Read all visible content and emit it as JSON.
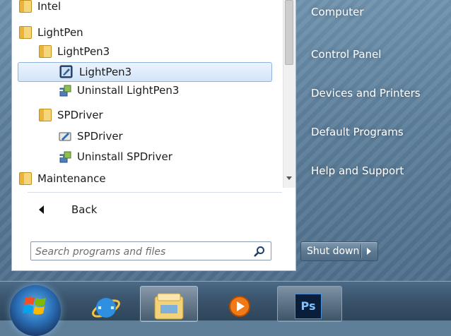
{
  "programs": {
    "items": [
      {
        "label": "Intel",
        "kind": "folder",
        "icon": "folder-icon",
        "indent": 0
      },
      {
        "label": "LightPen",
        "kind": "folder",
        "icon": "folder-icon",
        "indent": 0
      },
      {
        "label": "LightPen3",
        "kind": "folder",
        "icon": "folder-icon",
        "indent": 1
      },
      {
        "label": "LightPen3",
        "kind": "app",
        "icon": "lightpen-app-icon",
        "indent": 2,
        "selected": true
      },
      {
        "label": "Uninstall LightPen3",
        "kind": "app",
        "icon": "uninstall-icon",
        "indent": 2
      },
      {
        "label": "SPDriver",
        "kind": "folder",
        "icon": "folder-icon",
        "indent": 1
      },
      {
        "label": "SPDriver",
        "kind": "app",
        "icon": "spdriver-app-icon",
        "indent": 2
      },
      {
        "label": "Uninstall SPDriver",
        "kind": "app",
        "icon": "uninstall-icon",
        "indent": 2
      },
      {
        "label": "Maintenance",
        "kind": "folder",
        "icon": "folder-icon",
        "indent": 0
      }
    ]
  },
  "back": {
    "label": "Back",
    "icon": "back-arrow-icon"
  },
  "search": {
    "placeholder": "Search programs and files",
    "icon": "search-icon"
  },
  "right_pane": {
    "links": [
      {
        "label": "Computer",
        "name": "link-computer"
      },
      {
        "label": "Control Panel",
        "name": "link-control-panel"
      },
      {
        "label": "Devices and Printers",
        "name": "link-devices-and-printers"
      },
      {
        "label": "Default Programs",
        "name": "link-default-programs"
      },
      {
        "label": "Help and Support",
        "name": "link-help-and-support"
      }
    ]
  },
  "shutdown": {
    "label": "Shut down",
    "arrow_icon": "chevron-right-icon"
  },
  "taskbar": {
    "items": [
      {
        "name": "start-orb",
        "icon": "windows-logo-icon"
      },
      {
        "name": "internet-explorer",
        "icon": "internet-explorer-icon"
      },
      {
        "name": "windows-explorer",
        "icon": "folder-library-icon"
      },
      {
        "name": "media-player",
        "icon": "media-player-icon"
      },
      {
        "name": "photoshop",
        "icon": "photoshop-icon",
        "label": "Ps"
      }
    ]
  },
  "colors": {
    "selection_bg": "#d3e5f8",
    "selection_border": "#8fb3da",
    "right_pane_bg": "#5d7f9b",
    "taskbar_bg": "#3c566f"
  }
}
